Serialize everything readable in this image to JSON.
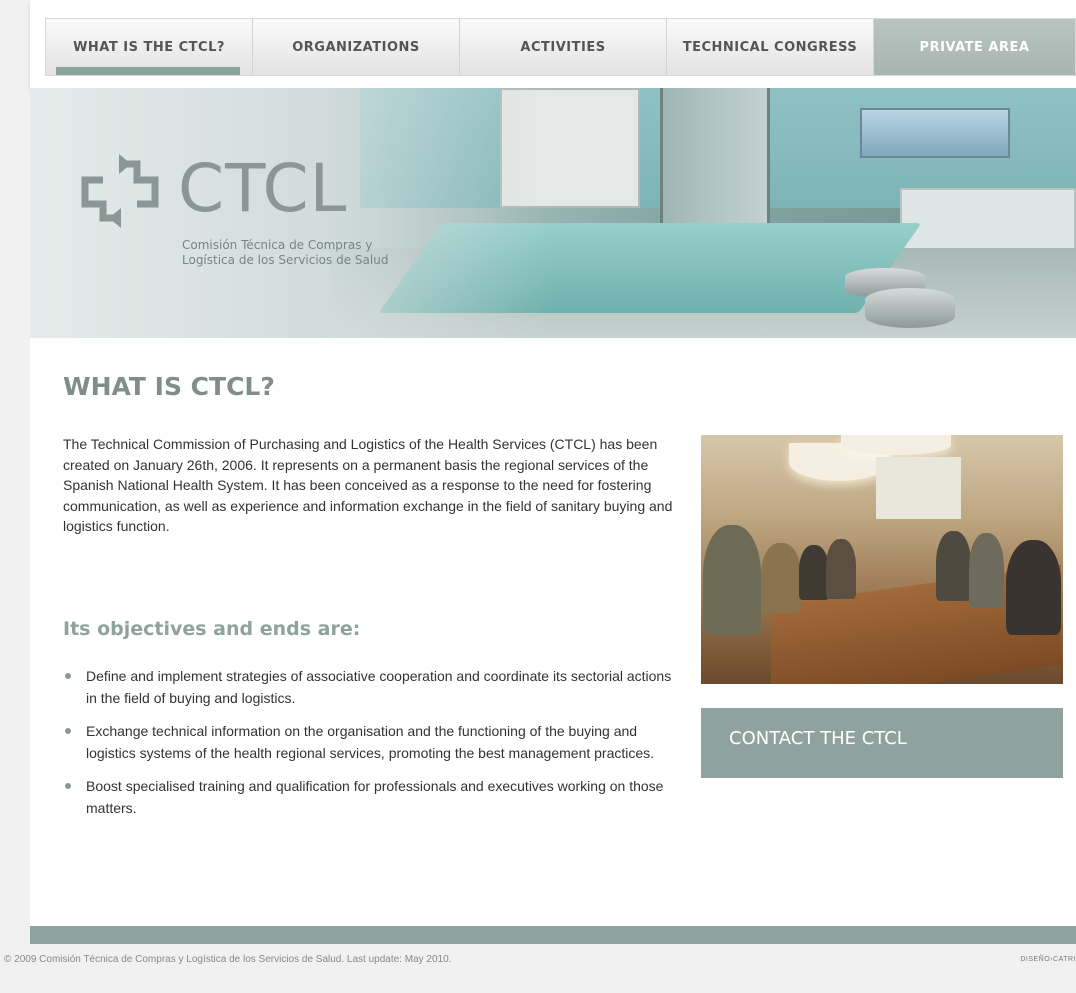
{
  "nav": {
    "items": [
      {
        "label": "WHAT IS THE CTCL?",
        "active": true
      },
      {
        "label": "ORGANIZATIONS"
      },
      {
        "label": "ACTIVITIES"
      },
      {
        "label": "TECHNICAL CONGRESS"
      },
      {
        "label": "PRIVATE AREA"
      }
    ]
  },
  "hero": {
    "logo_text": "CTCL",
    "logo_subtitle_line1": "Comisión Técnica de Compras y",
    "logo_subtitle_line2": "Logística de los Servicios de Salud"
  },
  "main": {
    "title": "WHAT IS CTCL?",
    "intro": "The Technical Commission of Purchasing and Logistics of the Health Services (CTCL) has been created on January 26th, 2006. It represents on a permanent basis the regional services of the Spanish National Health System. It has been conceived as a response to the need for fostering communication, as well as experience and information exchange in the field of sanitary buying and logistics function.",
    "objectives_title": "Its objectives and ends are:",
    "objectives": [
      "Define and implement strategies of associative cooperation and coordinate its sectorial actions in the field of buying and logistics.",
      "Exchange technical information on the organisation and the functioning of the buying and logistics systems of the health regional services, promoting the best management practices.",
      "Boost specialised training and qualification for professionals and executives working on those matters."
    ],
    "contact_label": "CONTACT THE CTCL"
  },
  "footer": {
    "copyright": "© 2009 Comisión Técnica de Compras y Logística de los Servicios de Salud.   Last update: May 2010.",
    "design_credit": "DISEÑO›CATRI"
  },
  "colors": {
    "accent": "#8fa29d",
    "title_gray": "#7f8d8b"
  }
}
